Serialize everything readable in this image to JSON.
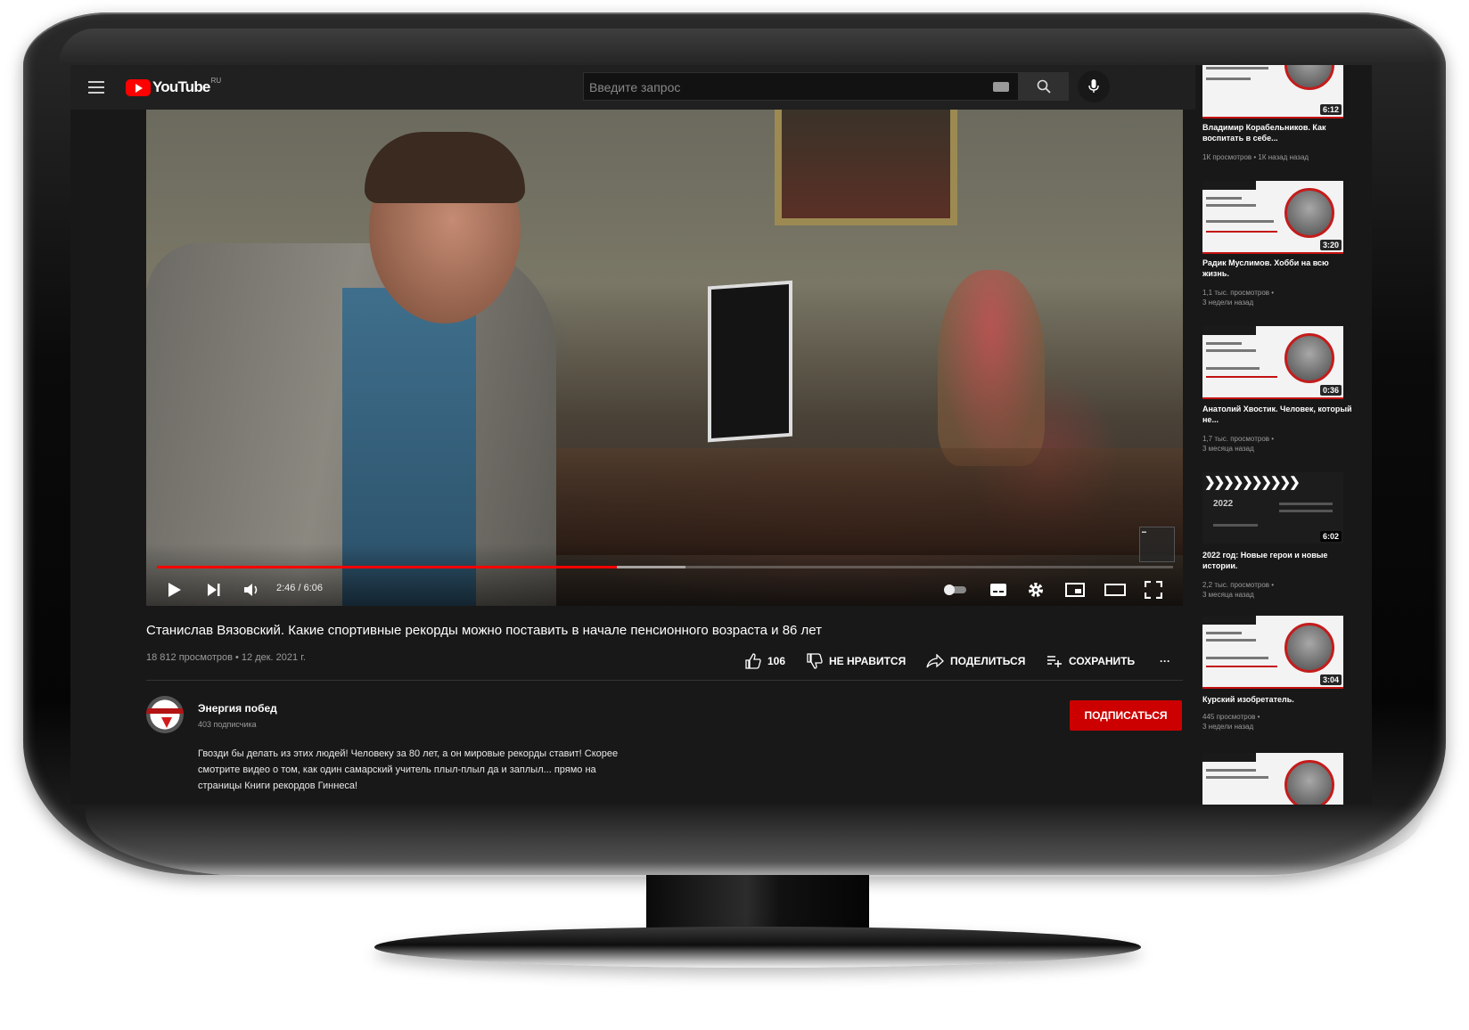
{
  "header": {
    "logo_text": "YouTube",
    "region": "RU",
    "search_placeholder": "Введите запрос"
  },
  "player": {
    "time": "2:46 / 6:06",
    "progress": 0.453,
    "buffered": 0.52
  },
  "video": {
    "title": "Станислав Вязовский. Какие спортивные рекорды можно поставить в начале пенсионного возраста и 86 лет",
    "views_date": "18 812 просмотров • 12 дек. 2021 г.",
    "likes": "106",
    "dislike_label": "НЕ НРАВИТСЯ",
    "share_label": "ПОДЕЛИТЬСЯ",
    "save_label": "СОХРАНИТЬ",
    "more_label": "···"
  },
  "channel": {
    "name": "Энергия побед",
    "subscribers": "403 подписчика",
    "subscribe_label": "ПОДПИСАТЬСЯ"
  },
  "description": {
    "line1": "Гвозди бы делать из этих людей! Человеку за 80 лет, а он мировые рекорды ставит!  Скорее",
    "line2": "смотрите  видео о том, как один самарский учитель плыл-плыл да и заплыл... прямо на",
    "line3": "страницы Книги рекордов Гиннеса!"
  },
  "recommendations": [
    {
      "title": "Владимир Корабельников. Как воспитать в себе...",
      "meta": "1К просмотров • 1К назад назад",
      "duration": "6:12"
    },
    {
      "title": "Радик Муслимов. Хобби на всю жизнь.",
      "meta": "1,1 тыс. просмотров •",
      "meta2": "3 недели назад",
      "duration": "3:20"
    },
    {
      "title": "Анатолий Хвостик. Человек, который не...",
      "meta": "1,7 тыс. просмотров •",
      "meta2": "3 месяца назад",
      "duration": "0:36"
    },
    {
      "title": "2022 год: Новые герои и новые истории.",
      "meta": "2,2 тыс. просмотров •",
      "meta2": "3 месяца назад",
      "duration": "6:02",
      "year": "2022"
    },
    {
      "title": "Курский изобретатель.",
      "meta": "445 просмотров •",
      "meta2": "3 недели назад",
      "duration": "3:04"
    }
  ],
  "colors": {
    "accent": "#ff0000",
    "subscribe_bg": "#cc0000",
    "background": "#181818",
    "header_bg": "#202020"
  }
}
